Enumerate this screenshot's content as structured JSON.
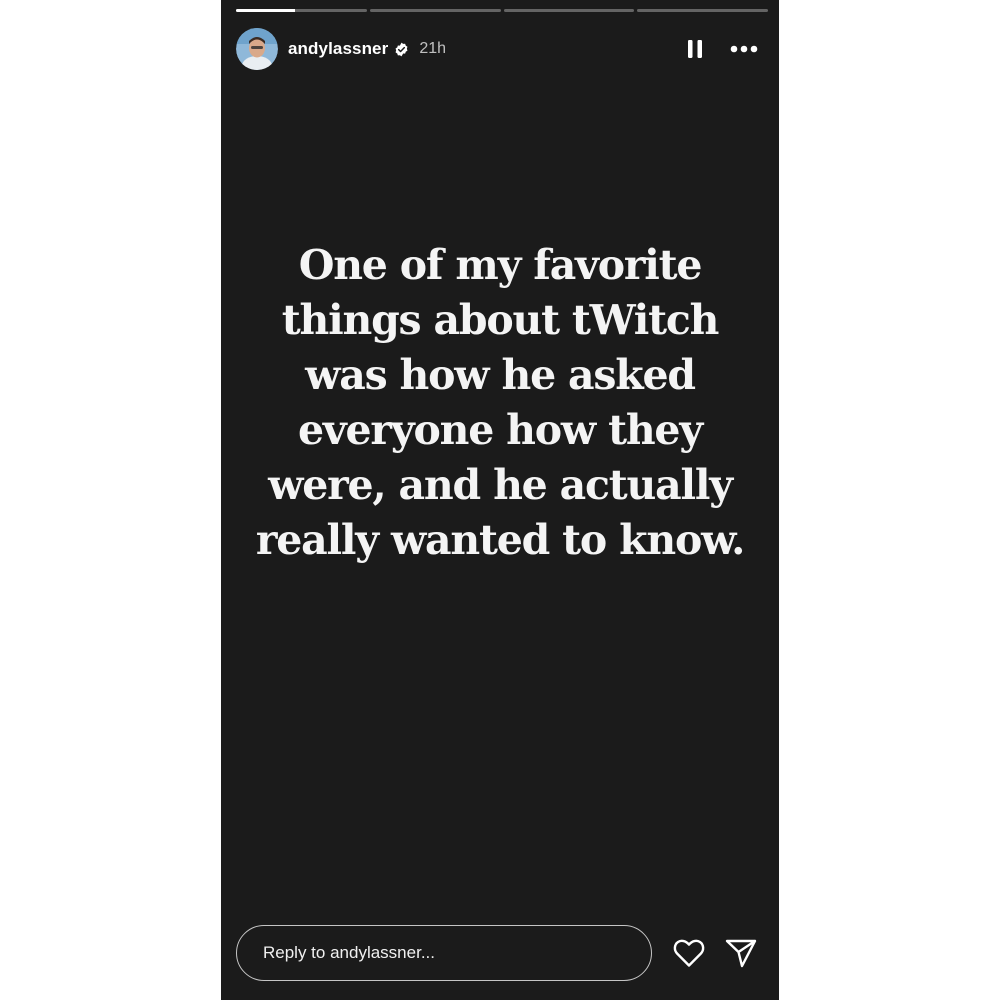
{
  "story": {
    "progress": {
      "segments": [
        1.0,
        0.0,
        0.0,
        0.0
      ],
      "current_segment_fraction": 0.45
    },
    "header": {
      "username": "andylassner",
      "verified": true,
      "timestamp": "21h",
      "icons": {
        "avatar": "avatar",
        "verified": "verified-badge-icon",
        "pause": "pause-icon",
        "more": "more-options-icon"
      }
    },
    "text": "One of my favorite things about tWitch was how he asked everyone how they were, and he actually really wanted to know.",
    "footer": {
      "reply_placeholder": "Reply to andylassner...",
      "icons": {
        "like": "heart-icon",
        "send": "send-icon"
      }
    },
    "colors": {
      "background": "#1b1b1b",
      "text": "#f4f4f4"
    }
  }
}
